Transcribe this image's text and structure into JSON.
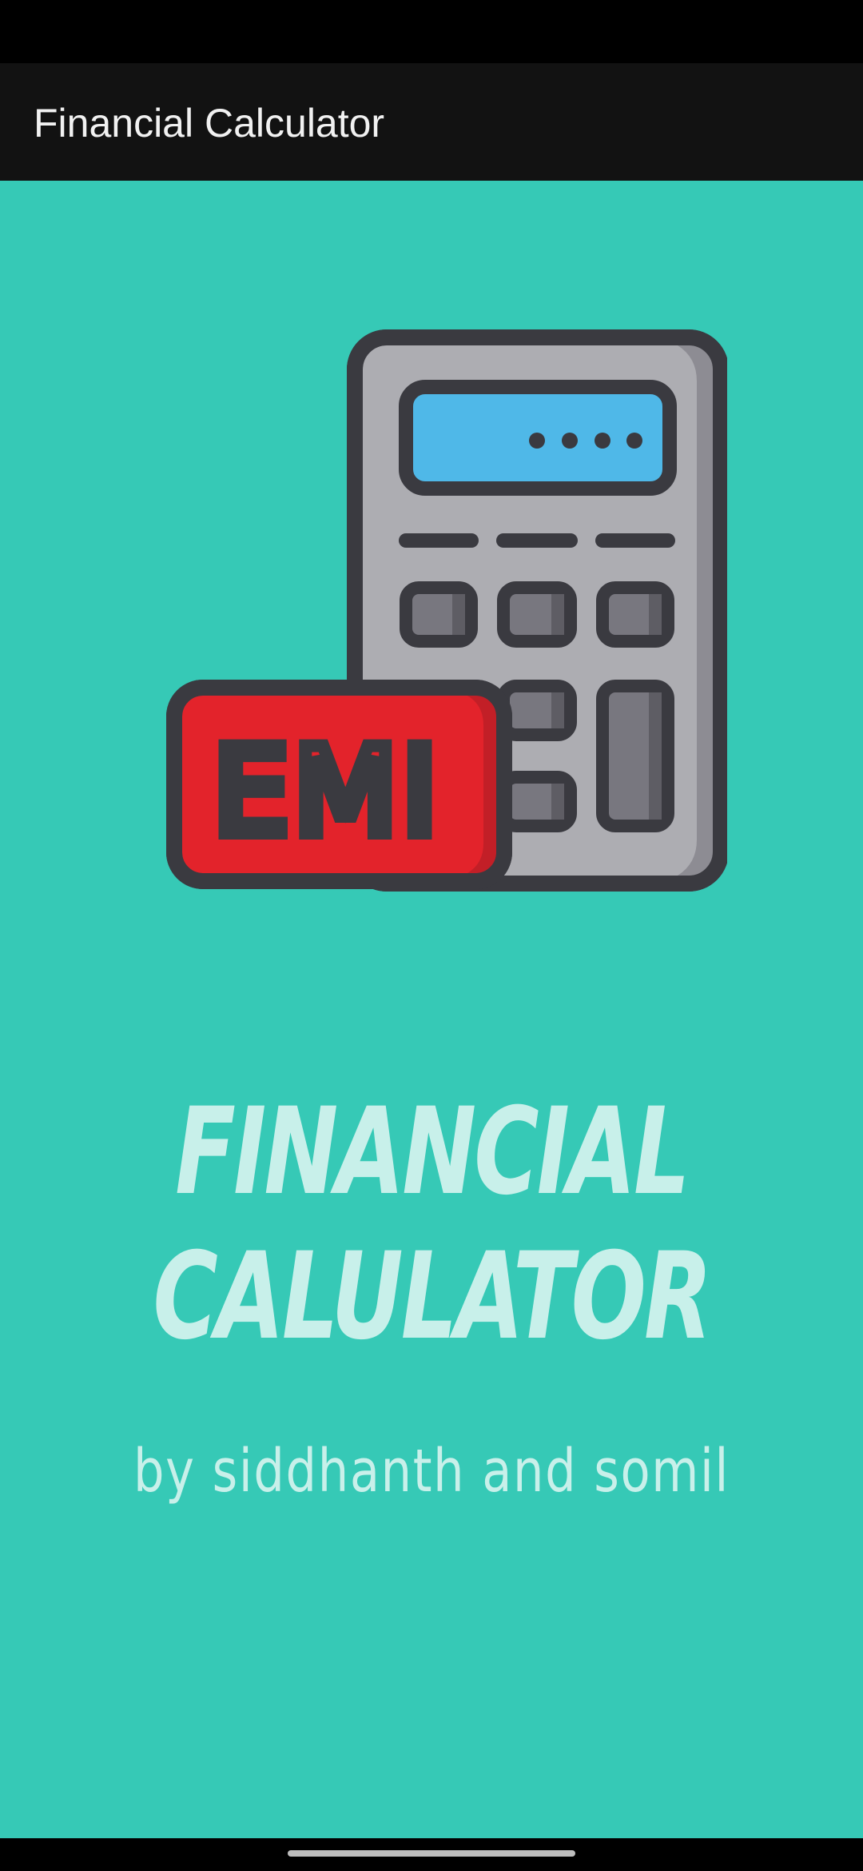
{
  "app_bar": {
    "title": "Financial Calculator"
  },
  "illustration": {
    "icon": "calculator-emi-icon",
    "badge_text": "EMI",
    "colors": {
      "outline": "#3a3a40",
      "body": "#adadb2",
      "body_shade": "#8d8c93",
      "screen": "#4fb8e8",
      "keys": "#78777f",
      "badge": "#e3232b",
      "badge_shade": "#c21f27"
    }
  },
  "headline": {
    "line1": "FINANCIAL",
    "line2": "CALULATOR"
  },
  "subtitle": "by siddhanth and somil",
  "colors": {
    "background": "#36c9b6",
    "app_bar": "#121212",
    "headline_text": "#c8f0ea",
    "status_bar": "#000000"
  }
}
